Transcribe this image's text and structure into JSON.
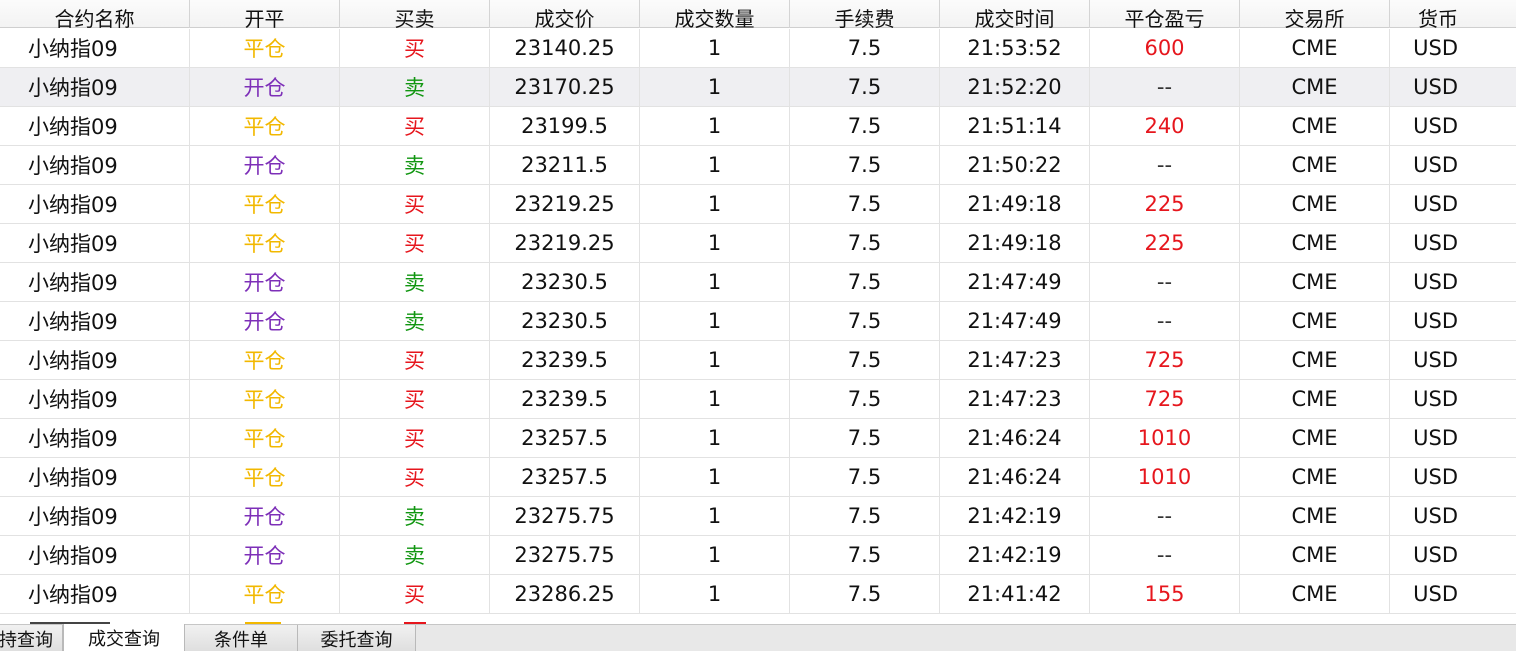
{
  "columns": [
    "合约名称",
    "开平",
    "买卖",
    "成交价",
    "成交数量",
    "手续费",
    "成交时间",
    "平仓盈亏",
    "交易所",
    "货币"
  ],
  "colors": {
    "open": "#7d2fb8",
    "close": "#f2b800",
    "buy": "#e6161d",
    "sell": "#119611",
    "profit": "#e6161d"
  },
  "rows": [
    {
      "name": "小纳指09",
      "openclose": "平仓",
      "side": "买",
      "price": "23140.25",
      "qty": "1",
      "fee": "7.5",
      "time": "21:53:52",
      "pnl": "600",
      "exchange": "CME",
      "currency": "USD"
    },
    {
      "name": "小纳指09",
      "openclose": "开仓",
      "side": "卖",
      "price": "23170.25",
      "qty": "1",
      "fee": "7.5",
      "time": "21:52:20",
      "pnl": "--",
      "exchange": "CME",
      "currency": "USD",
      "highlighted": true
    },
    {
      "name": "小纳指09",
      "openclose": "平仓",
      "side": "买",
      "price": "23199.5",
      "qty": "1",
      "fee": "7.5",
      "time": "21:51:14",
      "pnl": "240",
      "exchange": "CME",
      "currency": "USD"
    },
    {
      "name": "小纳指09",
      "openclose": "开仓",
      "side": "卖",
      "price": "23211.5",
      "qty": "1",
      "fee": "7.5",
      "time": "21:50:22",
      "pnl": "--",
      "exchange": "CME",
      "currency": "USD"
    },
    {
      "name": "小纳指09",
      "openclose": "平仓",
      "side": "买",
      "price": "23219.25",
      "qty": "1",
      "fee": "7.5",
      "time": "21:49:18",
      "pnl": "225",
      "exchange": "CME",
      "currency": "USD"
    },
    {
      "name": "小纳指09",
      "openclose": "平仓",
      "side": "买",
      "price": "23219.25",
      "qty": "1",
      "fee": "7.5",
      "time": "21:49:18",
      "pnl": "225",
      "exchange": "CME",
      "currency": "USD"
    },
    {
      "name": "小纳指09",
      "openclose": "开仓",
      "side": "卖",
      "price": "23230.5",
      "qty": "1",
      "fee": "7.5",
      "time": "21:47:49",
      "pnl": "--",
      "exchange": "CME",
      "currency": "USD"
    },
    {
      "name": "小纳指09",
      "openclose": "开仓",
      "side": "卖",
      "price": "23230.5",
      "qty": "1",
      "fee": "7.5",
      "time": "21:47:49",
      "pnl": "--",
      "exchange": "CME",
      "currency": "USD"
    },
    {
      "name": "小纳指09",
      "openclose": "平仓",
      "side": "买",
      "price": "23239.5",
      "qty": "1",
      "fee": "7.5",
      "time": "21:47:23",
      "pnl": "725",
      "exchange": "CME",
      "currency": "USD"
    },
    {
      "name": "小纳指09",
      "openclose": "平仓",
      "side": "买",
      "price": "23239.5",
      "qty": "1",
      "fee": "7.5",
      "time": "21:47:23",
      "pnl": "725",
      "exchange": "CME",
      "currency": "USD"
    },
    {
      "name": "小纳指09",
      "openclose": "平仓",
      "side": "买",
      "price": "23257.5",
      "qty": "1",
      "fee": "7.5",
      "time": "21:46:24",
      "pnl": "1010",
      "exchange": "CME",
      "currency": "USD"
    },
    {
      "name": "小纳指09",
      "openclose": "平仓",
      "side": "买",
      "price": "23257.5",
      "qty": "1",
      "fee": "7.5",
      "time": "21:46:24",
      "pnl": "1010",
      "exchange": "CME",
      "currency": "USD"
    },
    {
      "name": "小纳指09",
      "openclose": "开仓",
      "side": "卖",
      "price": "23275.75",
      "qty": "1",
      "fee": "7.5",
      "time": "21:42:19",
      "pnl": "--",
      "exchange": "CME",
      "currency": "USD"
    },
    {
      "name": "小纳指09",
      "openclose": "开仓",
      "side": "卖",
      "price": "23275.75",
      "qty": "1",
      "fee": "7.5",
      "time": "21:42:19",
      "pnl": "--",
      "exchange": "CME",
      "currency": "USD"
    },
    {
      "name": "小纳指09",
      "openclose": "平仓",
      "side": "买",
      "price": "23286.25",
      "qty": "1",
      "fee": "7.5",
      "time": "21:41:42",
      "pnl": "155",
      "exchange": "CME",
      "currency": "USD"
    }
  ],
  "tabs": [
    {
      "label": "持查询",
      "active": false
    },
    {
      "label": "成交查询",
      "active": true
    },
    {
      "label": "条件单",
      "active": false
    },
    {
      "label": "委托查询",
      "active": false
    }
  ]
}
